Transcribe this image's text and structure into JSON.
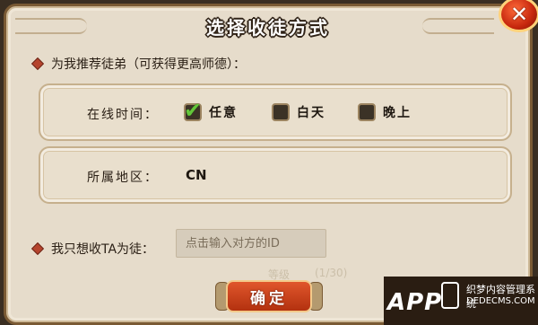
{
  "dialog": {
    "title": "选择收徒方式",
    "close_label": "✕"
  },
  "recommend_section": {
    "label": "为我推荐徒弟（可获得更高师德）："
  },
  "online_time": {
    "label": "在线时间：",
    "options": [
      {
        "label": "任意",
        "checked": true
      },
      {
        "label": "白天",
        "checked": false
      },
      {
        "label": "晚上",
        "checked": false
      }
    ]
  },
  "region": {
    "label": "所属地区：",
    "value": "CN"
  },
  "target": {
    "label": "我只想收TA为徒：",
    "placeholder": "点击输入对方的ID"
  },
  "confirm": {
    "label": "确定"
  },
  "background_text": {
    "line1": "(1/30)",
    "line2": "等级"
  },
  "watermark": {
    "brand": "APP",
    "cn": "织梦内容管理系统",
    "url": "DEDECMS.COM"
  },
  "colors": {
    "accent": "#b3310f",
    "check": "#63c63a",
    "frame": "#7a5a34"
  }
}
